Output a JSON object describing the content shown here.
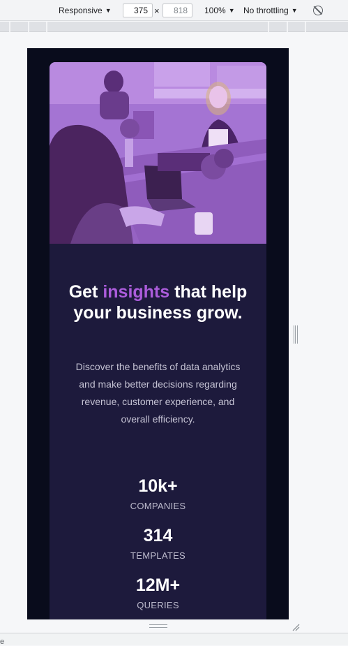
{
  "toolbar": {
    "device": "Responsive",
    "width": "375",
    "height": "818",
    "times": "×",
    "zoom": "100%",
    "throttle": "No throttling",
    "rotate_icon": "rotate-icon"
  },
  "card": {
    "image_alt": "Women working together at a table with laptops",
    "headline_pre": "Get ",
    "headline_accent": "insights",
    "headline_post": " that help your business grow.",
    "description": "Discover the benefits of data analytics and make better decisions regarding revenue, customer experience, and overall efficiency.",
    "stats": [
      {
        "number": "10k+",
        "label": "COMPANIES"
      },
      {
        "number": "314",
        "label": "TEMPLATES"
      },
      {
        "number": "12M+",
        "label": "QUERIES"
      }
    ],
    "colors": {
      "accent": "#ab5cdb",
      "card_bg": "#1d1a3c",
      "page_bg": "#090c1c"
    }
  },
  "status": {
    "text": "e"
  }
}
